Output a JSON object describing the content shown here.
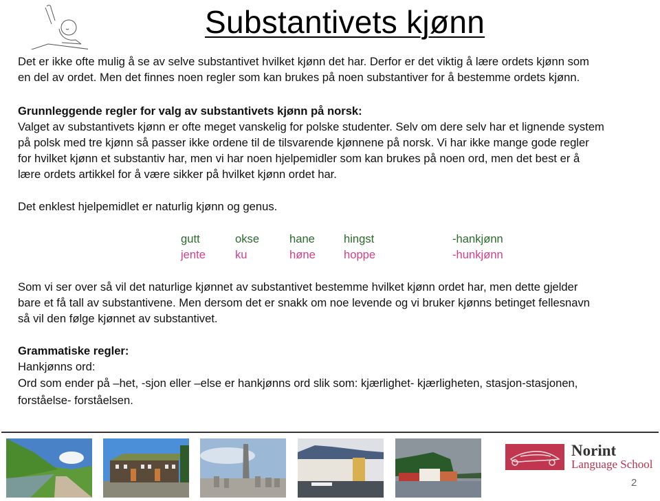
{
  "header": {
    "title": "Substantivets kjønn",
    "clipart": "child-raising-hand-drawing"
  },
  "intro": {
    "lines": [
      "Det er ikke ofte mulig å se av selve substantivet hvilket kjønn det har.  Derfor er det viktig å lære ordets kjønn som",
      "en del av ordet.  Men det finnes noen regler som kan brukes på noen substantiver for å bestemme ordets kjønn."
    ]
  },
  "basic_rules": {
    "heading": "Grunnleggende regler for valg av substantivets kjønn på norsk:",
    "lines": [
      "Valget av substantivets kjønn er ofte meget vanskelig for polske studenter. Selv om dere selv har et lignende system",
      "på polsk med tre kjønn så passer ikke ordene til de tilsvarende kjønnene på norsk. Vi har ikke mange gode regler",
      "for hvilket kjønn et substantiv har, men vi har noen hjelpemidler som kan brukes på noen ord, men det best er å",
      "lære ordets artikkel for å være sikker på hvilket kjønn ordet har."
    ],
    "simplest": "Det enklest hjelpemidlet er naturlig kjønn og genus."
  },
  "gender_table": {
    "colors": {
      "masculine": "#2a6a2a",
      "feminine": "#d0408a"
    },
    "masculine": {
      "words": [
        "gutt",
        "okse",
        "hane",
        "hingst"
      ],
      "label": "-hankjønn"
    },
    "feminine": {
      "words": [
        "jente",
        "ku",
        "høne",
        "hoppe"
      ],
      "label": "-hunkjønn"
    }
  },
  "natural_gender": {
    "lines": [
      "Som vi ser over så vil det naturlige kjønnet av substantivet bestemme hvilket kjønn ordet har, men dette gjelder",
      "bare et få tall av substantivene. Men dersom det er snakk om noe levende og vi bruker kjønns betinget fellesnavn",
      "så vil den følge kjønnet av substantivet."
    ]
  },
  "grammar_rules": {
    "heading": "Grammatiske regler:",
    "subheading": "Hankjønns ord:",
    "lines": [
      "Ord som ender på –het, -sjon eller –else er hankjønns ord slik som: kjærlighet- kjærligheten, stasjon-stasjonen,",
      "forståelse- forståelsen."
    ]
  },
  "footer": {
    "photos": [
      "mountain-valley-path",
      "grass-roof-farmhouse",
      "stone-monolith-park",
      "harbor-town-buildings",
      "red-boathouses-fjord"
    ],
    "logo": {
      "name": "Norint",
      "subtitle": "Language School",
      "color": "#c0364f"
    },
    "page_number": "2"
  }
}
